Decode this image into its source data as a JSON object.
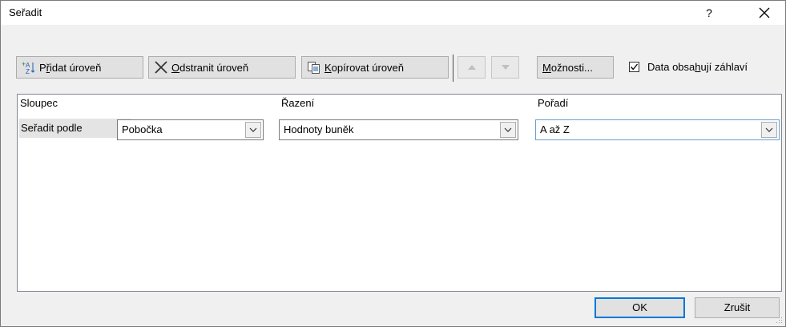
{
  "dialog": {
    "title": "Seřadit",
    "help": "?"
  },
  "toolbar": {
    "add_prefix": "P",
    "add_accel": "ř",
    "add_suffix": "idat úroveň",
    "delete_accel": "O",
    "delete_suffix": "dstranit úroveň",
    "copy_accel": "K",
    "copy_suffix": "opírovat úroveň",
    "options_accel": "M",
    "options_suffix": "ožnosti...",
    "header_check_prefix": "Data obsa",
    "header_check_accel": "h",
    "header_check_suffix": "ují záhlaví",
    "header_checked": true
  },
  "grid": {
    "headers": {
      "column": "Sloupec",
      "sort_on": "Řazení",
      "order": "Pořadí"
    },
    "row": {
      "label": "Seřadit podle",
      "column_value": "Pobočka",
      "sort_on_value": "Hodnoty buněk",
      "order_value": "A až Z"
    }
  },
  "buttons": {
    "ok": "OK",
    "cancel": "Zrušit"
  }
}
